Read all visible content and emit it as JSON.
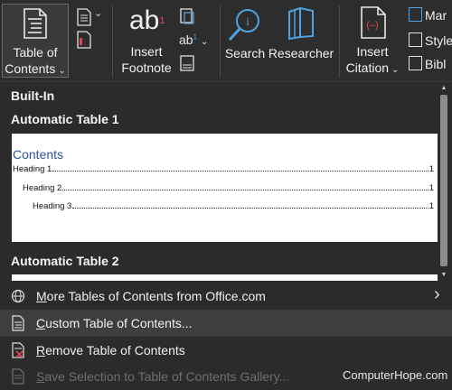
{
  "ribbon": {
    "toc_label_line1": "Table of",
    "toc_label_line2": "Contents",
    "footnote_glyph": "ab",
    "footnote_sup": "1",
    "insert_footnote_line1": "Insert",
    "insert_footnote_line2": "Footnote",
    "small_ab": "ab",
    "small_ab_sup": "1",
    "search_label": "Search",
    "researcher_label": "Researcher",
    "insert_citation_line1": "Insert",
    "insert_citation_line2": "Citation",
    "side_items": [
      "Mar",
      "Style",
      "Bibl"
    ]
  },
  "dropdown": {
    "builtin_label": "Built-In",
    "auto_table_1_label": "Automatic Table 1",
    "auto_table_2_label": "Automatic Table 2",
    "preview": {
      "title": "Contents",
      "entries": [
        {
          "text": "Heading 1",
          "page": "1"
        },
        {
          "text": "Heading 2",
          "page": "1"
        },
        {
          "text": "Heading 3",
          "page": "1"
        }
      ]
    },
    "menu": {
      "more_tables_pre": "M",
      "more_tables_rest": "ore Tables of Contents from Office.com",
      "more_tables_arrow": "›",
      "custom_pre": "C",
      "custom_rest": "ustom Table of Contents...",
      "remove_pre": "R",
      "remove_rest": "emove Table of Contents",
      "save_pre": "S",
      "save_rest": "ave Selection to Table of Contents Gallery..."
    }
  },
  "watermark": "ComputerHope.com",
  "colors": {
    "accent_blue": "#4fa3e0",
    "accent_red": "#e0454f",
    "toc_title_blue": "#2f5597"
  }
}
